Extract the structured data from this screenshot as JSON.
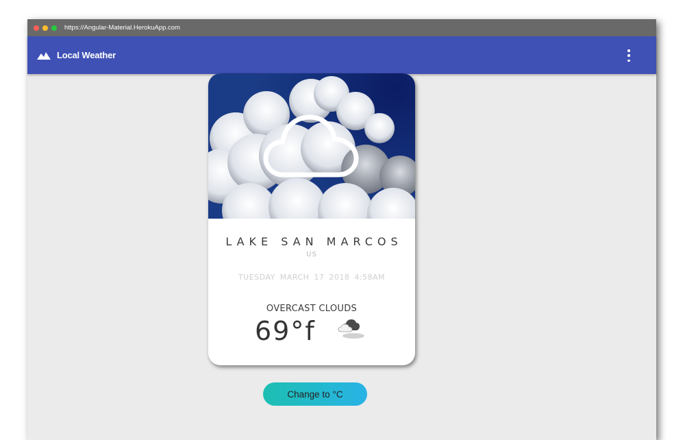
{
  "browser": {
    "url": "https://Angular-Material.HerokuApp.com",
    "window_controls": [
      {
        "name": "close",
        "color": "#ff5f56"
      },
      {
        "name": "minimize",
        "color": "#ffbd2e"
      },
      {
        "name": "maximize",
        "color": "#27c93f"
      }
    ]
  },
  "toolbar": {
    "logo_icon": "mountains-icon",
    "title": "Local Weather",
    "menu_icon": "more-vert-icon",
    "color": "#3f51b5"
  },
  "card": {
    "photo_icon": "cloud-outline-icon",
    "city": "LAKE SAN MARCOS",
    "country": "US",
    "datetime": "TUESDAY MARCH 17 2018 4:58AM",
    "condition": "OVERCAST CLOUDS",
    "temperature": "69°f",
    "condition_icon": "overcast-cloud-icon"
  },
  "actions": {
    "change_unit_label": "Change to °C"
  }
}
